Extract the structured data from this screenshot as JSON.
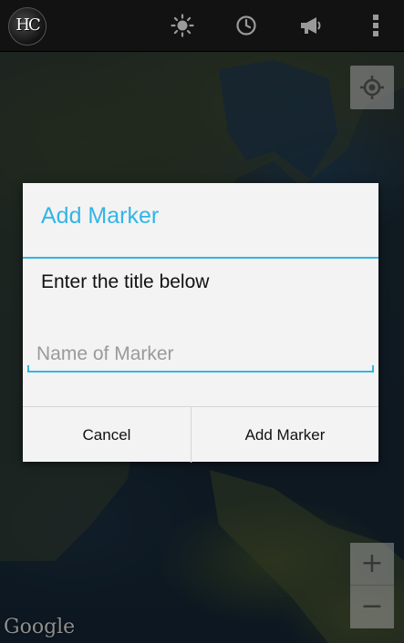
{
  "app": {
    "logo_text": "HC"
  },
  "toolbar": {
    "icons": [
      "brightness-icon",
      "clock-icon",
      "megaphone-icon",
      "overflow-menu-icon"
    ]
  },
  "map": {
    "attribution": "Google",
    "zoom_in_label": "+",
    "zoom_out_label": "−"
  },
  "dialog": {
    "title": "Add Marker",
    "message": "Enter the title below",
    "input_value": "",
    "input_placeholder": "Name of Marker",
    "cancel_label": "Cancel",
    "confirm_label": "Add Marker"
  },
  "colors": {
    "accent": "#33b5e5",
    "actionbar": "#121212",
    "dialog_bg": "#f3f3f3"
  }
}
